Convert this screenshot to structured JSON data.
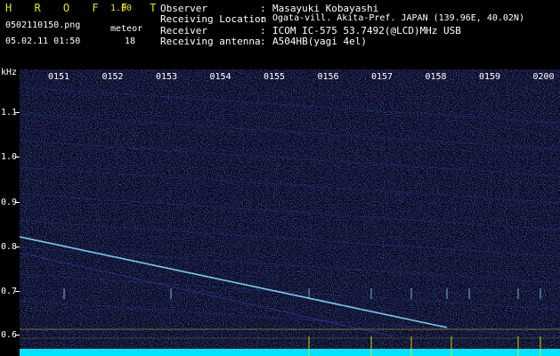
{
  "header": {
    "app_name": "H R O F F T",
    "version": "1.00",
    "filename": "0502110150.png",
    "datetime": "05.02.11 01:50",
    "meteor_label": "meteor",
    "meteor_count": "18",
    "fields": [
      {
        "label": "Observer",
        "sep": ":",
        "value": "Masayuki Kobayashi"
      },
      {
        "label": "Receiving Location",
        "sep": ":",
        "value": "Ogata-vill. Akita-Pref. JAPAN (139.96E, 40.02N)"
      },
      {
        "label": "Receiver",
        "sep": ":",
        "value": "ICOM IC-575 53.7492(@LCD)MHz USB"
      },
      {
        "label": "Receiving antenna",
        "sep": ":",
        "value": "A504HB(yagi 4el)"
      }
    ]
  },
  "spectrogram": {
    "unit_label": "kHz",
    "y_ticks": [
      "1.1",
      "1.0",
      "0.9",
      "0.8",
      "0.7",
      "0.6"
    ],
    "time_labels": [
      "0151",
      "0152",
      "0153",
      "0154",
      "0155",
      "0156",
      "0157",
      "0158",
      "0159",
      "0200"
    ],
    "colors": {
      "background": "#0a0a2e",
      "noise": "#2a3aa8",
      "signal": "#7fe0ff",
      "baseline": "#00e5ff",
      "marker": "#e6e600"
    }
  }
}
